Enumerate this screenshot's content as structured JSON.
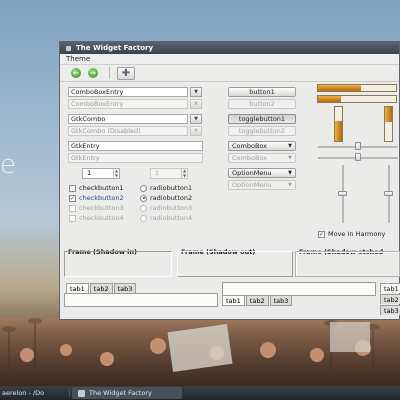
{
  "desktop": {
    "bg_text": "e"
  },
  "window": {
    "title": "The Widget Factory",
    "menu": [
      "Theme"
    ],
    "toolbar": {
      "back_icon": "arrow-left-icon",
      "forward_icon": "arrow-right-icon",
      "add_icon": "plus-icon"
    }
  },
  "col1": {
    "combobox_entry": "ComboBoxEntry",
    "combobox_entry_disabled": "ComboBoxEntry",
    "gtkcombo": "GtkCombo",
    "gtkcombo_disabled": "GtkCombo (Disabled)",
    "gtkentry": "GtkEntry",
    "gtkentry_disabled": "GtkEntry",
    "spin1": "1",
    "spin2": "1",
    "checks": [
      {
        "label": "checkbutton1",
        "checked": false,
        "disabled": false
      },
      {
        "label": "checkbutton2",
        "checked": true,
        "disabled": false
      },
      {
        "label": "checkbutton3",
        "checked": false,
        "disabled": true
      },
      {
        "label": "checkbutton4",
        "checked": false,
        "disabled": true
      }
    ],
    "radios": [
      {
        "label": "radiobutton1",
        "selected": false,
        "disabled": false
      },
      {
        "label": "radiobutton2",
        "selected": true,
        "disabled": false
      },
      {
        "label": "radiobutton3",
        "selected": false,
        "disabled": true
      },
      {
        "label": "radiobutton4",
        "selected": false,
        "disabled": true
      }
    ]
  },
  "col2": {
    "button1": "button1",
    "button2": "button2",
    "toggle1": "togglebutton1",
    "toggle2": "togglebutton2",
    "combo1": "ComboBox",
    "combo2": "ComboBox",
    "option1": "OptionMenu",
    "option2": "OptionMenu"
  },
  "col3": {
    "progress_h1": 0.55,
    "progress_h2": 0.3,
    "progress_v1": 0.6,
    "progress_v2": 0.45,
    "scale_h1": 0.5,
    "scale_h2": 0.5,
    "scale_v1": 0.5,
    "scale_v2": 0.5,
    "move_in_harmony": "Move In Harmony",
    "move_in_harmony_checked": true
  },
  "frames": {
    "shadow_in": "Frame (Shadow in)",
    "shadow_out": "Frame (Shadow out)",
    "shadow_etched": "Frame (Shadow etched"
  },
  "notebooks": {
    "nb1_tabs": [
      "tab1",
      "tab2",
      "tab3"
    ],
    "nb2_tabs": [
      "tab1",
      "tab2",
      "tab3"
    ],
    "nb3_tabs": [
      "tab1",
      "tab2",
      "tab3"
    ]
  },
  "taskbar": {
    "item1": "aerelon - /Do",
    "item2": "The Widget Factory"
  }
}
